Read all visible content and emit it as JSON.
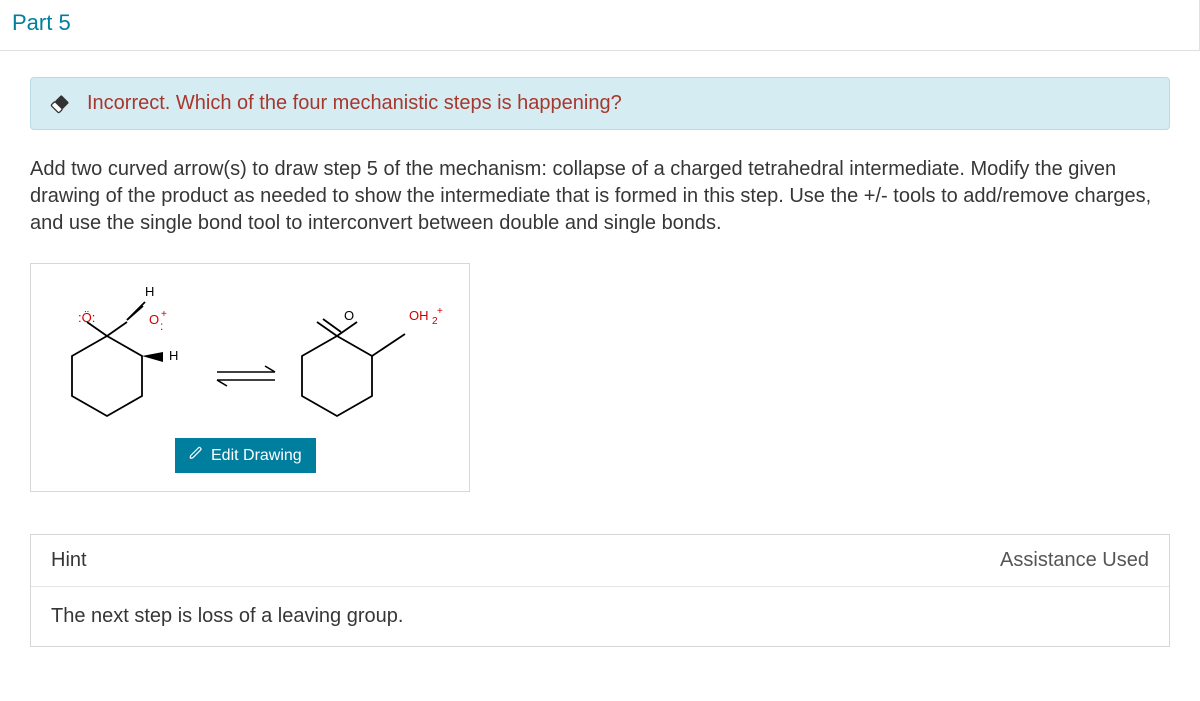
{
  "part_title": "Part 5",
  "feedback": "Incorrect. Which of the four mechanistic steps is happening?",
  "instructions": "Add two curved arrow(s) to draw step 5 of the mechanism: collapse of a charged tetrahedral intermediate. Modify the given drawing of the product as needed to show the intermediate that is formed in this step. Use the +/- tools to add/remove charges, and use the single bond tool to interconvert between double and single bonds.",
  "edit_button": "Edit Drawing",
  "hint": {
    "title": "Hint",
    "assistance": "Assistance Used",
    "body": "The next step is loss of a leaving group."
  },
  "molecule": {
    "left": {
      "top_label": "H",
      "o_lone": ":Ö:",
      "o_plus": "O",
      "plus": "+",
      "h2": "H"
    },
    "right": {
      "o": "O",
      "oh2": "OH",
      "sub": "2",
      "plus": "+"
    }
  }
}
